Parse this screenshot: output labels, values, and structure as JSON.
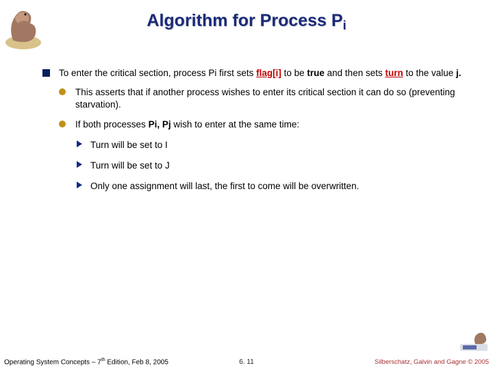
{
  "title": {
    "main": "Algorithm for Process P",
    "sub": "i"
  },
  "bullets": {
    "l1_a_pre": "To enter the critical section, process Pi first sets ",
    "l1_a_flag": "flag[i]",
    "l1_a_mid1": " to be ",
    "l1_a_true": "true",
    "l1_a_mid2": " and then sets ",
    "l1_a_turn": "turn",
    "l1_a_mid3": " to the value ",
    "l1_a_j": "j.",
    "l2_a": "This asserts that if another process wishes to enter its critical section it can do so (preventing starvation).",
    "l2_b_pre": "If both processes ",
    "l2_b_pij": "Pi, Pj",
    "l2_b_post": " wish to enter at the same time:",
    "l3_a": "Turn will be set to I",
    "l3_b": "Turn will be set to J",
    "l3_c": "Only one assignment will last, the first to come will be overwritten."
  },
  "footer": {
    "left_pre": "Operating System Concepts – 7",
    "left_sup": "th",
    "left_post": " Edition, Feb 8, 2005",
    "center": "6. 11",
    "right": "Silberschatz, Galvin and Gagne © 2005"
  }
}
